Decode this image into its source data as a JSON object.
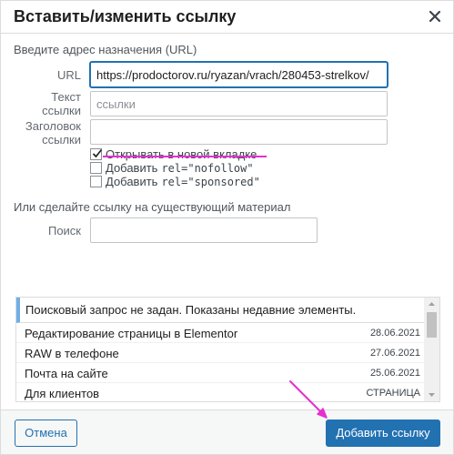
{
  "dialog": {
    "title": "Вставить/изменить ссылку"
  },
  "url_section": {
    "heading": "Введите адрес назначения (URL)",
    "url_label": "URL",
    "url_value": "https://prodoctorov.ru/ryazan/vrach/280453-strelkov/",
    "link_text_label_line1": "Текст",
    "link_text_label_line2": "ссылки",
    "link_text_placeholder": "ссылки",
    "title_label_line1": "Заголовок",
    "title_label_line2": "ссылки",
    "title_value": ""
  },
  "options": {
    "new_tab": {
      "label": "Открывать в новой вкладке",
      "checked": true
    },
    "nofollow": {
      "prefix": "Добавить ",
      "code": "rel=\"nofollow\"",
      "checked": false
    },
    "sponsored": {
      "prefix": "Добавить ",
      "code": "rel=\"sponsored\"",
      "checked": false
    }
  },
  "search_section": {
    "heading": "Или сделайте ссылку на существующий материал",
    "search_label": "Поиск",
    "search_value": ""
  },
  "results": {
    "notice": "Поисковый запрос не задан. Показаны недавние элементы.",
    "items": [
      {
        "title": "Редактирование страницы в Elementor",
        "info": "28.06.2021"
      },
      {
        "title": "RAW в телефоне",
        "info": "27.06.2021"
      },
      {
        "title": "Почта на сайте",
        "info": "25.06.2021"
      },
      {
        "title": "Для клиентов",
        "info": "СТРАНИЦА"
      }
    ]
  },
  "footer": {
    "cancel_label": "Отмена",
    "submit_label": "Добавить ссылку"
  },
  "colors": {
    "accent": "#2271b1",
    "annotation": "#e52fd0",
    "notice_border": "#72aee6"
  },
  "icons": {
    "close": "close-icon",
    "checkmark": "checkmark-icon",
    "scroll_up": "scroll-up-arrow-icon",
    "scroll_down": "scroll-down-arrow-icon",
    "annotation_arrow": "pointer-arrow-annotation"
  }
}
